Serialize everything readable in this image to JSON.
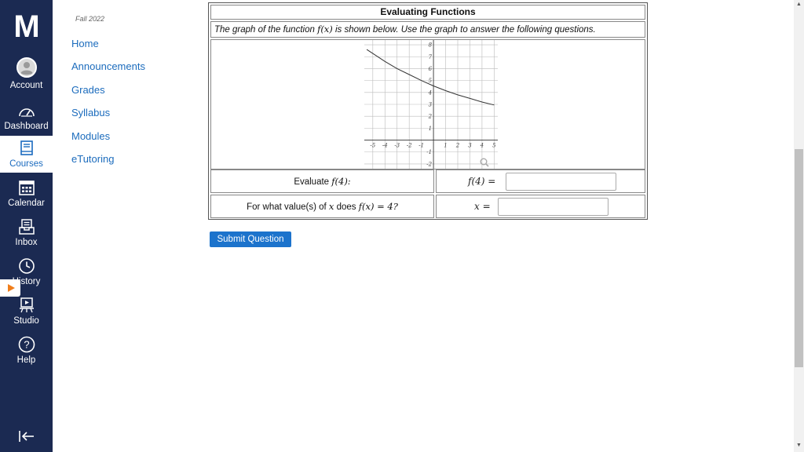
{
  "global_nav": {
    "logo": "M",
    "items": [
      {
        "label": "Account",
        "icon": "account-icon"
      },
      {
        "label": "Dashboard",
        "icon": "dashboard-icon"
      },
      {
        "label": "Courses",
        "icon": "courses-icon",
        "active": true
      },
      {
        "label": "Calendar",
        "icon": "calendar-icon"
      },
      {
        "label": "Inbox",
        "icon": "inbox-icon"
      },
      {
        "label": "History",
        "icon": "history-icon"
      },
      {
        "label": "Studio",
        "icon": "studio-icon"
      },
      {
        "label": "Help",
        "icon": "help-icon"
      }
    ],
    "colors": {
      "background": "#1b2a52",
      "active_text": "#1b6bbf",
      "history_flag": "#f07e1b"
    }
  },
  "course_nav": {
    "term": "Fall 2022",
    "links": [
      "Home",
      "Announcements",
      "Grades",
      "Syllabus",
      "Modules",
      "eTutoring"
    ],
    "link_color": "#1c6cbd"
  },
  "question": {
    "title": "Evaluating Functions",
    "prompt_before": "The graph of the function ",
    "prompt_func": "f(x)",
    "prompt_after": " is shown below. Use the graph to answer the following questions.",
    "q1_text": "Evaluate ",
    "q1_math": "f(4):",
    "q1_answer_label": "f(4) =",
    "q1_answer_value": "",
    "q2_text_a": "For what value(s) of ",
    "q2_math_x": "x",
    "q2_text_b": " does ",
    "q2_math_b": "f(x) = 4?",
    "q2_answer_label": "x =",
    "q2_answer_value": "",
    "submit_label": "Submit Question"
  },
  "chart_data": {
    "type": "line",
    "title": "",
    "xlabel": "",
    "ylabel": "",
    "xlim": [
      -5.7,
      5.3
    ],
    "ylim": [
      -2.4,
      8.4
    ],
    "x_ticks": [
      -5,
      -4,
      -3,
      -2,
      -1,
      1,
      2,
      3,
      4,
      5
    ],
    "y_ticks": [
      -2,
      -1,
      1,
      2,
      3,
      4,
      5,
      6,
      7,
      8
    ],
    "grid": true,
    "series": [
      {
        "x": [
          -5.5,
          -4,
          -3,
          -2,
          -1,
          0,
          1,
          2,
          3,
          4,
          5
        ],
        "y": [
          7.6,
          6.6,
          6.0,
          5.5,
          5.0,
          4.55,
          4.15,
          3.8,
          3.5,
          3.2,
          2.95
        ]
      }
    ],
    "colors": {
      "curve": "#333333",
      "grid": "#bbbbbb",
      "axis": "#333333"
    }
  }
}
